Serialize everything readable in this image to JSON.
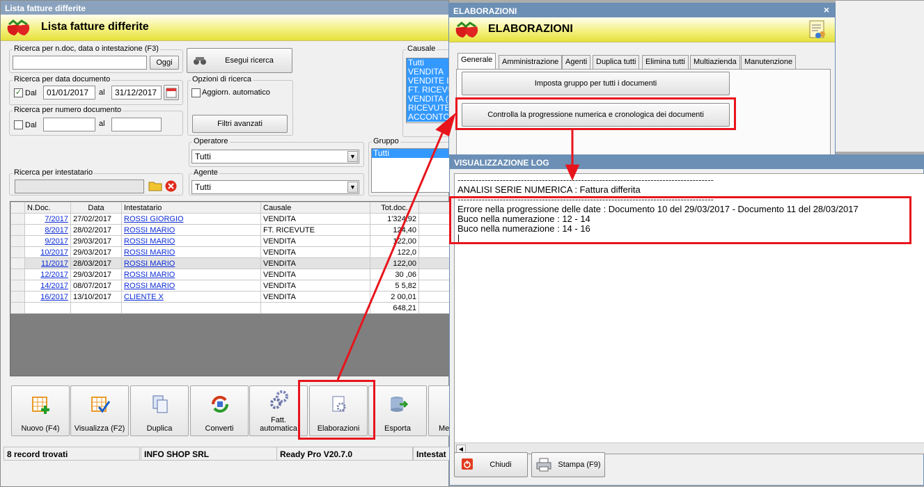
{
  "main_window": {
    "title": "Lista fatture differite",
    "header_title": "Lista fatture differite",
    "search_text": {
      "label": "Ricerca per n.doc, data o intestazione (F3)",
      "value": "",
      "today_button": "Oggi"
    },
    "execute_search": "Esegui ricerca",
    "date_search": {
      "label": "Ricerca per data documento",
      "from_checked": true,
      "from_label": "Dal",
      "from_value": "01/01/2017",
      "to_label": "al",
      "to_value": "31/12/2017"
    },
    "number_search": {
      "label": "Ricerca per numero documento",
      "from_checked": false,
      "from_label": "Dal",
      "from_value": "",
      "to_label": "al",
      "to_value": ""
    },
    "search_options": {
      "label": "Opzioni di ricerca",
      "auto_update_label": "Aggiorn. automatico",
      "auto_update_checked": false,
      "advanced_filters": "Filtri avanzati"
    },
    "causale": {
      "label": "Causale",
      "items": [
        "Tutti",
        "VENDITA",
        "VENDITE D",
        "FT. RICEVU",
        "VENDITA (",
        "RICEVUTE",
        "ACCONTO"
      ]
    },
    "operatore": {
      "label": "Operatore",
      "value": "Tutti"
    },
    "agente": {
      "label": "Agente",
      "value": "Tutti"
    },
    "gruppo": {
      "label": "Gruppo",
      "items": [
        "Tutti"
      ]
    },
    "holder_search": {
      "label": "Ricerca per intestatario",
      "value": ""
    },
    "table": {
      "columns": [
        "N.Doc.",
        "Data",
        "Intestatario",
        "Causale",
        "Tot.doc."
      ],
      "rows": [
        {
          "ndoc": "7/2017",
          "data": "27/02/2017",
          "intestatario": "ROSSI GIORGIO",
          "causale": "VENDITA",
          "tot": "1'324,92"
        },
        {
          "ndoc": "8/2017",
          "data": "28/02/2017",
          "intestatario": "ROSSI MARIO",
          "causale": "FT. RICEVUTE",
          "tot": "124,40"
        },
        {
          "ndoc": "9/2017",
          "data": "29/03/2017",
          "intestatario": "ROSSI MARIO",
          "causale": "VENDITA",
          "tot": "122,00"
        },
        {
          "ndoc": "10/2017",
          "data": "29/03/2017",
          "intestatario": "ROSSI MARIO",
          "causale": "VENDITA",
          "tot": "122,0"
        },
        {
          "ndoc": "11/2017",
          "data": "28/03/2017",
          "intestatario": "ROSSI MARIO",
          "causale": "VENDITA",
          "tot": "122,00"
        },
        {
          "ndoc": "12/2017",
          "data": "29/03/2017",
          "intestatario": "ROSSI MARIO",
          "causale": "VENDITA",
          "tot": "30 ,06"
        },
        {
          "ndoc": "14/2017",
          "data": "08/07/2017",
          "intestatario": "ROSSI MARIO",
          "causale": "VENDITA",
          "tot": "5 5,82"
        },
        {
          "ndoc": "16/2017",
          "data": "13/10/2017",
          "intestatario": "CLIENTE X",
          "causale": "VENDITA",
          "tot": "2 00,01"
        }
      ],
      "total": "648,21"
    },
    "toolbar": [
      "Nuovo (F4)",
      "Visualizza (F2)",
      "Duplica",
      "Converti",
      "Fatt. automatica",
      "Elaborazioni",
      "Esporta",
      "Me"
    ],
    "status": [
      "8 record trovati",
      "INFO SHOP SRL",
      "Ready Pro V20.7.0",
      "Intestat"
    ]
  },
  "elab_window": {
    "title": "ELABORAZIONI",
    "header_title": "ELABORAZIONI",
    "close": "×",
    "tabs": [
      "Generale",
      "Amministrazione",
      "Agenti",
      "Duplica tutti",
      "Elimina tutti",
      "Multiazienda",
      "Manutenzione"
    ],
    "buttons": [
      "Imposta gruppo per tutti i documenti",
      "Controlla la progressione numerica e cronologica dei documenti"
    ]
  },
  "log_window": {
    "title": "VISUALIZZAZIONE LOG",
    "lines": [
      "-------------------------------------------------------------------------------------",
      "ANALISI SERIE NUMERICA : Fattura differita",
      "-------------------------------------------------------------------------------------",
      "Errore nella progressione delle date : Documento 10 del 29/03/2017 - Documento 11 del 28/03/2017",
      "Buco nella numerazione : 12 - 14",
      "Buco nella numerazione : 14 - 16"
    ],
    "close_button": "Chiudi",
    "print_button": "Stampa (F9)"
  },
  "colors": {
    "annotation": "#e8141c",
    "selection": "#3399ff",
    "title_bar": "#6b8fb5"
  }
}
